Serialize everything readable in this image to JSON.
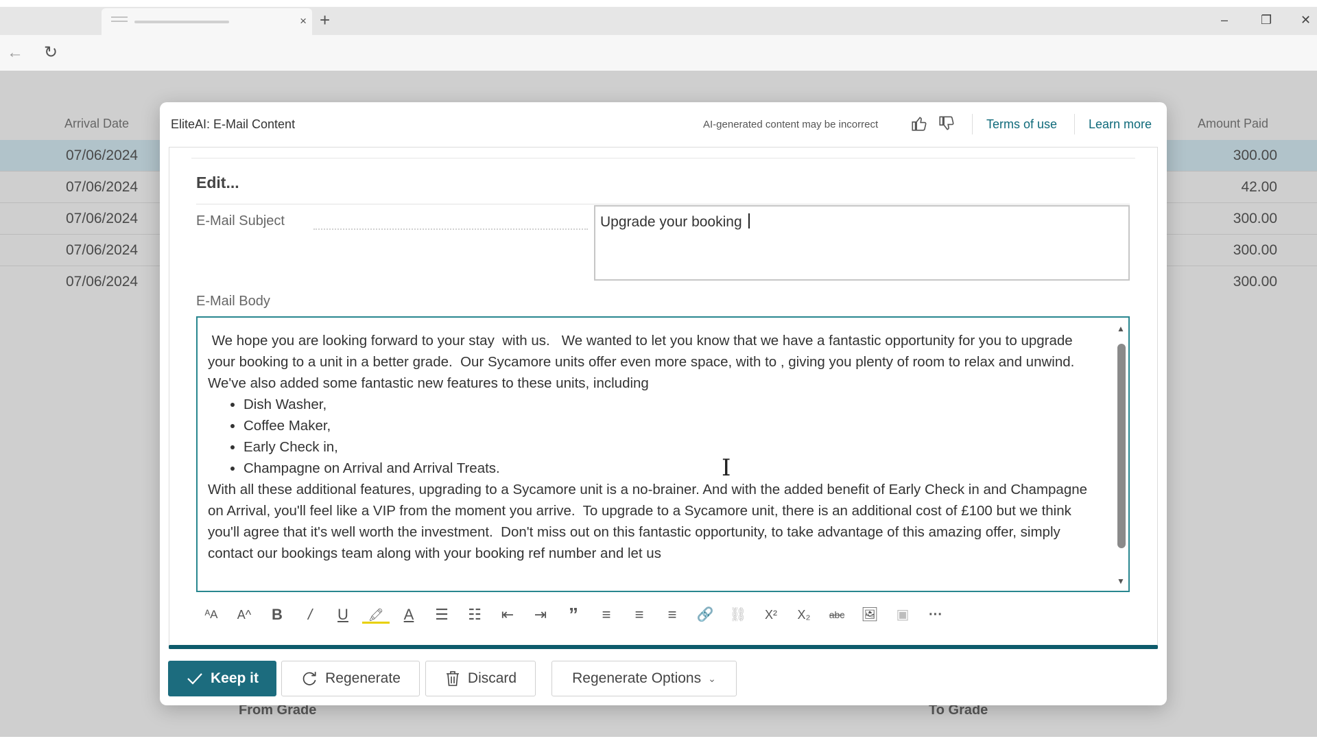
{
  "browser": {
    "tab_close": "×",
    "new_tab": "+",
    "minimize": "–",
    "maximize": "❐",
    "close": "✕",
    "back_icon": "←",
    "refresh_icon": "↻"
  },
  "background": {
    "arrival_date_header": "Arrival Date",
    "amount_paid_header": "Amount Paid",
    "rows": [
      {
        "date": "07/06/2024",
        "amount": "300.00"
      },
      {
        "date": "07/06/2024",
        "amount": "42.00"
      },
      {
        "date": "07/06/2024",
        "amount": "300.00"
      },
      {
        "date": "07/06/2024",
        "amount": "300.00"
      },
      {
        "date": "07/06/2024",
        "amount": "300.00"
      }
    ],
    "from_grade": "From Grade",
    "to_grade": "To Grade"
  },
  "dialog": {
    "title": "EliteAI: E-Mail Content",
    "disclaimer": "AI-generated content may be incorrect",
    "terms_link": "Terms of use",
    "learn_more_link": "Learn more",
    "edit_heading": "Edit...",
    "subject_label": "E-Mail Subject",
    "subject_value": "Upgrade your booking ",
    "body_label": "E-Mail Body",
    "body": {
      "p1": " We hope you are looking forward to your stay  with us.   We wanted to let you know that we have a fantastic opportunity for you to upgrade your booking to a unit in a better grade.  Our Sycamore units offer even more space, with to , giving you plenty of room to relax and unwind.",
      "p2": "We've also added some fantastic new features to these units, including",
      "bullets": [
        "Dish Washer,",
        "Coffee Maker,",
        "Early Check in,",
        "Champagne on Arrival and Arrival Treats."
      ],
      "p3": "With all these additional features, upgrading to a Sycamore unit is a no-brainer. And with the added benefit of Early Check in and Champagne on Arrival, you'll feel like a VIP from the moment you arrive.  To upgrade to a Sycamore unit, there is an additional cost of £100 but we think you'll agree that it's well worth the investment.  Don't miss out on this fantastic opportunity, to take advantage of this amazing offer, simply contact our bookings team along with your booking ref number and let us"
    },
    "toolbar": {
      "font_size": "ᴬA",
      "font_grow": "A^",
      "bold": "B",
      "italic": "/",
      "underline": "U",
      "highlight": "🖍",
      "font_color": "A",
      "bullets": "☰",
      "numbering": "☷",
      "outdent": "⇤",
      "indent": "⇥",
      "quote": "”",
      "align_left": "≡",
      "align_center": "≡",
      "align_right": "≡",
      "link": "🔗",
      "unlink": "⛓",
      "superscript": "X²",
      "subscript": "X₂",
      "strikethrough": "abc",
      "image": "🖼",
      "image_alt": "▣",
      "more": "···"
    },
    "buttons": {
      "keep": "Keep it",
      "regenerate": "Regenerate",
      "discard": "Discard",
      "regenerate_options": "Regenerate Options"
    }
  },
  "colors": {
    "accent": "#1c6c7e",
    "accent_line": "#0e5b6b",
    "link": "#0f6a7a",
    "selected_row": "#cfe4ec"
  }
}
